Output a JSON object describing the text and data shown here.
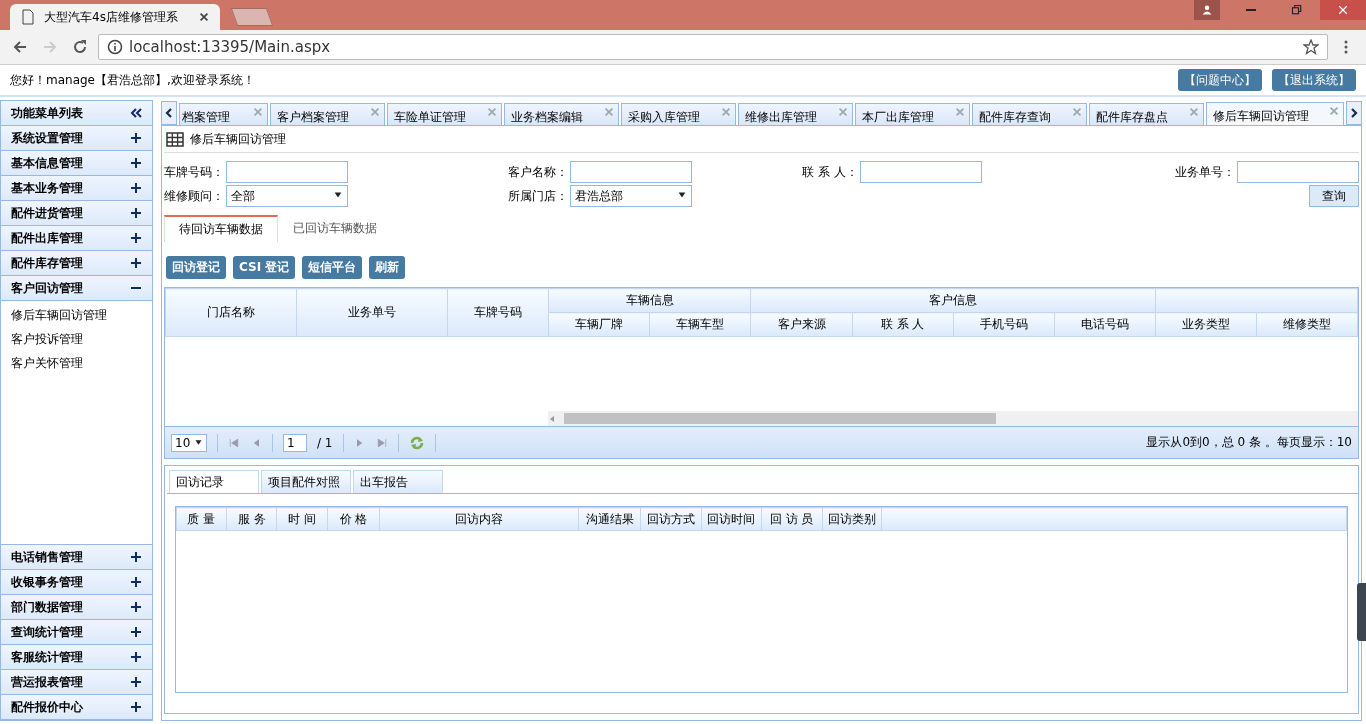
{
  "browser": {
    "tab_title": "大型汽车4s店维修管理系",
    "address": "localhost:13395/Main.aspx"
  },
  "header": {
    "greeting": "您好！manage【君浩总部】,欢迎登录系统！",
    "buttons": [
      "【问题中心】",
      "【退出系统】"
    ]
  },
  "sidebar": {
    "title": "功能菜单列表",
    "groups": [
      {
        "label": "系统设置管理",
        "expanded": false
      },
      {
        "label": "基本信息管理",
        "expanded": false
      },
      {
        "label": "基本业务管理",
        "expanded": false
      },
      {
        "label": "配件进货管理",
        "expanded": false
      },
      {
        "label": "配件出库管理",
        "expanded": false
      },
      {
        "label": "配件库存管理",
        "expanded": false
      },
      {
        "label": "客户回访管理",
        "expanded": true,
        "children": [
          "修后车辆回访管理",
          "客户投诉管理",
          "客户关怀管理"
        ]
      },
      {
        "label": "电话销售管理",
        "expanded": false
      },
      {
        "label": "收银事务管理",
        "expanded": false
      },
      {
        "label": "部门数据管理",
        "expanded": false
      },
      {
        "label": "查询统计管理",
        "expanded": false
      },
      {
        "label": "客服统计管理",
        "expanded": false
      },
      {
        "label": "营运报表管理",
        "expanded": false
      },
      {
        "label": "配件报价中心",
        "expanded": false
      }
    ]
  },
  "tabs": [
    {
      "label": "档案管理",
      "selected": false
    },
    {
      "label": "客户档案管理",
      "selected": false
    },
    {
      "label": "车险单证管理",
      "selected": false
    },
    {
      "label": "业务档案编辑",
      "selected": false
    },
    {
      "label": "采购入库管理",
      "selected": false
    },
    {
      "label": "维修出库管理",
      "selected": false
    },
    {
      "label": "本厂出库管理",
      "selected": false
    },
    {
      "label": "配件库存查询",
      "selected": false
    },
    {
      "label": "配件库存盘点",
      "selected": false
    },
    {
      "label": "修后车辆回访管理",
      "selected": true
    }
  ],
  "page_title": "修后车辆回访管理",
  "filters": [
    {
      "label": "车牌号码：",
      "kind": "text"
    },
    {
      "label": "客户名称：",
      "kind": "text"
    },
    {
      "label": "联 系 人：",
      "kind": "text"
    },
    {
      "label": "业务单号：",
      "kind": "text"
    },
    {
      "label": "维修顾问：",
      "kind": "select",
      "value": "全部"
    },
    {
      "label": "所属门店：",
      "kind": "select",
      "value": "君浩总部"
    }
  ],
  "query_button": "查询",
  "sub_tabs": [
    {
      "label": "待回访车辆数据",
      "selected": true
    },
    {
      "label": "已回访车辆数据",
      "selected": false
    }
  ],
  "actions": [
    "回访登记",
    "CSI 登记",
    "短信平台",
    "刷新"
  ],
  "grid": {
    "columns": [
      {
        "label": "门店名称"
      },
      {
        "label": "业务单号"
      },
      {
        "label": "车牌号码"
      },
      {
        "label": "车辆信息",
        "children": [
          "车辆厂牌",
          "车辆车型"
        ]
      },
      {
        "label": "客户信息",
        "children": [
          "客户来源",
          "联 系 人",
          "手机号码",
          "电话号码"
        ]
      },
      {
        "children": [
          "业务类型",
          "维修类型"
        ]
      }
    ]
  },
  "pager": {
    "page_size": "10",
    "page": "1",
    "total_pages": "/ 1",
    "summary": "显示从0到0，总 0 条 。每页显示：10"
  },
  "detail_tabs": [
    {
      "label": "回访记录",
      "selected": true
    },
    {
      "label": "项目配件对照",
      "selected": false
    },
    {
      "label": "出车报告",
      "selected": false
    }
  ],
  "detail_grid": {
    "columns": [
      "质 量",
      "服 务",
      "时 间",
      "价 格",
      "回访内容",
      "沟通结果",
      "回访方式",
      "回访时间",
      "回 访 员",
      "回访类别"
    ]
  }
}
